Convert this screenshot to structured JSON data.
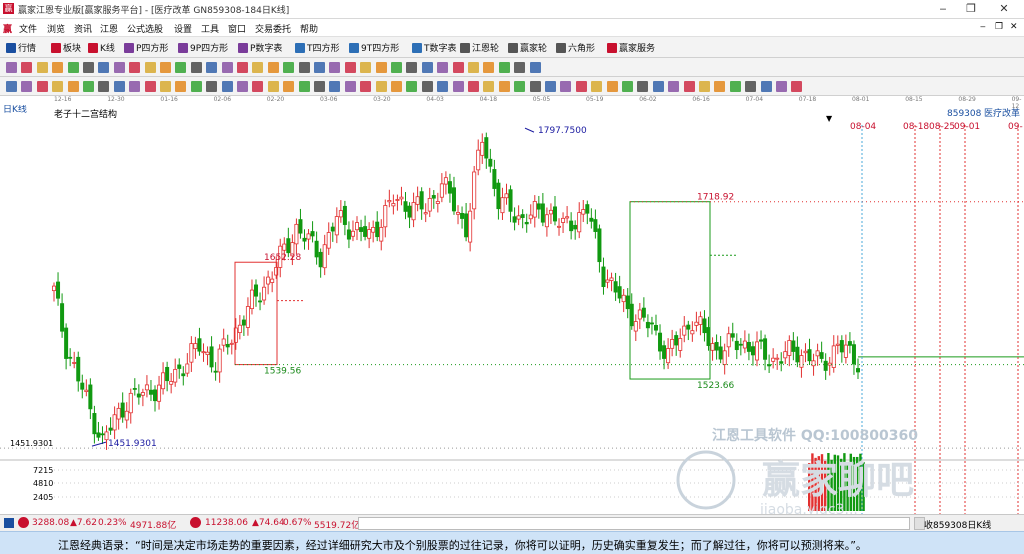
{
  "window": {
    "title": "赢家江恩专业版[赢家服务平台] - [医疗改革  GN859308-184日K线]",
    "logo": "赢",
    "buttons": [
      "‒",
      "❐",
      "✕"
    ],
    "inner_buttons": [
      "‒",
      "❐",
      "✕"
    ]
  },
  "menu": {
    "icon": "赢",
    "items": [
      "文件",
      "浏览",
      "资讯",
      "江恩",
      "公式选股",
      "设置",
      "工具",
      "窗口",
      "交易委托",
      "帮助"
    ]
  },
  "toolbar": {
    "items": [
      {
        "label": "行情",
        "icon": "grid-icon",
        "color": "#1a4fa0"
      },
      {
        "label": "板块",
        "icon": "blocks-icon",
        "color": "#c8102e"
      },
      {
        "label": "K线",
        "icon": "candle-icon",
        "color": "#c8102e"
      },
      {
        "label": "P四方形",
        "icon": "p-square-icon",
        "color": "#7a3c9a"
      },
      {
        "label": "9P四方形",
        "icon": "9p-square-icon",
        "color": "#7a3c9a"
      },
      {
        "label": "P数字表",
        "icon": "p-table-icon",
        "color": "#7a3c9a"
      },
      {
        "label": "T四方形",
        "icon": "t-square-icon",
        "color": "#2d6fb6"
      },
      {
        "label": "9T四方形",
        "icon": "9t-square-icon",
        "color": "#2d6fb6"
      },
      {
        "label": "T数字表",
        "icon": "t-table-icon",
        "color": "#2d6fb6"
      },
      {
        "label": "江恩轮",
        "icon": "wheel-icon",
        "color": "#555"
      },
      {
        "label": "赢家轮",
        "icon": "wheel2-icon",
        "color": "#555"
      },
      {
        "label": "六角形",
        "icon": "hexagon-icon",
        "color": "#555"
      },
      {
        "label": "赢家服务",
        "icon": "service-icon",
        "color": "#c8102e"
      }
    ]
  },
  "timeaxis": {
    "ticks": [
      "12-16",
      "12-30",
      "01-16",
      "02-06",
      "02-20",
      "03-06",
      "03-20",
      "04-03",
      "04-18",
      "05-05",
      "05-19",
      "06-02",
      "06-16",
      "07-04",
      "07-18",
      "08-01",
      "08-15",
      "08-29",
      "09-12"
    ]
  },
  "chart_data": {
    "type": "candlestick",
    "period_label": "日K线",
    "indicator_label": "老子十二宫结构",
    "symbol_code": "859308",
    "symbol_name": "医疗改革",
    "y_left_labels": [
      {
        "text": "1451.9301",
        "value": 1451.93
      }
    ],
    "annotations": [
      {
        "text": "1797.7500",
        "value": 1797.75,
        "color": "#1a1aa0"
      },
      {
        "text": "1718.92",
        "value": 1718.92,
        "color": "#c8102e"
      },
      {
        "text": "1652.28",
        "value": 1652.28,
        "color": "#c8102e"
      },
      {
        "text": "1539.56",
        "value": 1539.56,
        "color": "#1a8a1a"
      },
      {
        "text": "1523.66",
        "value": 1523.66,
        "color": "#1a8a1a"
      },
      {
        "text": "1451.9301",
        "value": 1451.93,
        "color": "#1a1aa0"
      }
    ],
    "future_dates": [
      "08-04",
      "08-18",
      "08-25",
      "09-01",
      "09-"
    ],
    "volume_labels": [
      "7215",
      "4810",
      "2405"
    ],
    "watermarks": [
      "江恩工具软件  QQ:100800360",
      "赢家聊吧",
      "jiaoba.yjgc3..."
    ],
    "colors": {
      "up": "#e23030",
      "down": "#119911",
      "box_red": "#e23030",
      "box_green": "#1a9a1a",
      "future": "#e23030",
      "current": "#4aa8d8"
    }
  },
  "status": {
    "index1": {
      "value": "3288.08",
      "change": "▲7.62",
      "pct": "0.23%",
      "amount": "4971.88亿"
    },
    "index2": {
      "value": "11238.06",
      "change": "▲74.64",
      "pct": "0.67%",
      "amount": "5519.72亿"
    },
    "right": "收859308日K线"
  },
  "quote": {
    "text": "江恩经典语录：“时间是决定市场走势的重要因素，经过详细研究大市及个别股票的过往记录，你将可以证明，历史确实重复发生；而了解过往，你将可以预测将来。”。"
  }
}
